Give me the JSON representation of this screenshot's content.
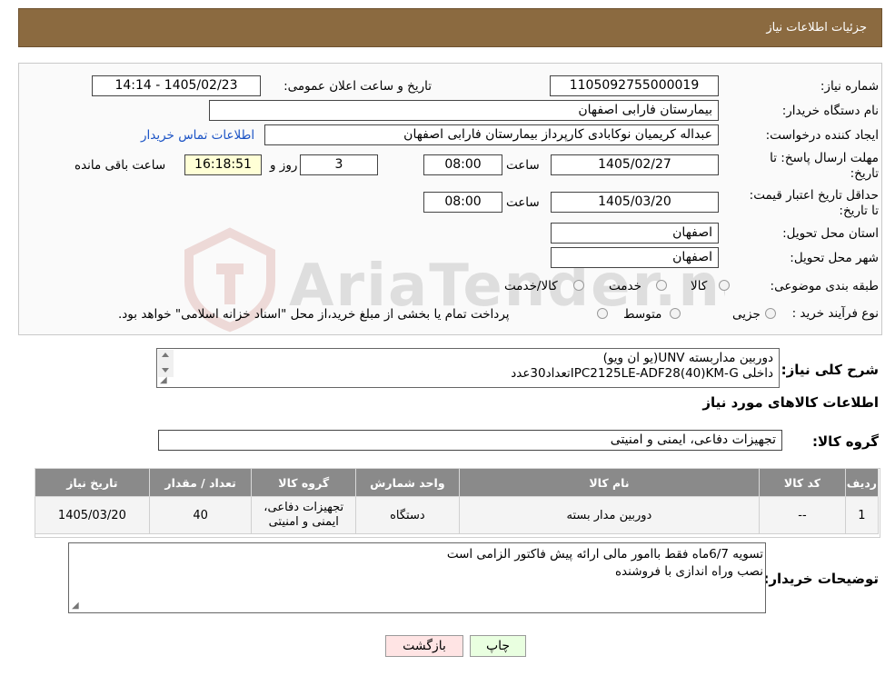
{
  "header": {
    "title": "جزئیات اطلاعات نیاز"
  },
  "form": {
    "need_number_label": "شماره نیاز:",
    "need_number": "1105092755000019",
    "announce_label": "تاریخ و ساعت اعلان عمومی:",
    "announce_value": "1405/02/23 - 14:14",
    "buyer_org_label": "نام دستگاه خریدار:",
    "buyer_org": "بیمارستان فارابی اصفهان",
    "creator_label": "ایجاد کننده درخواست:",
    "creator": "عبداله کریمیان نوکابادی کارپرداز بیمارستان فارابی اصفهان",
    "contact_link": "اطلاعات تماس خریدار",
    "deadline_label": "مهلت ارسال پاسخ: تا تاریخ:",
    "deadline_date": "1405/02/27",
    "time_label": "ساعت",
    "deadline_time": "08:00",
    "days_value": "3",
    "days_label": "روز و",
    "remaining_time": "16:18:51",
    "remaining_label": "ساعت باقی مانده",
    "validity_label": "حداقل تاریخ اعتبار قیمت: تا تاریخ:",
    "validity_date": "1405/03/20",
    "validity_time": "08:00",
    "province_label": "استان محل تحویل:",
    "province": "اصفهان",
    "city_label": "شهر محل تحویل:",
    "city": "اصفهان",
    "category_label": "طبقه بندی موضوعی:",
    "category_options": [
      "کالا",
      "خدمت",
      "کالا/خدمت"
    ],
    "process_label": "نوع فرآیند خرید :",
    "process_options": [
      "جزیی",
      "متوسط"
    ],
    "process_note": "پرداخت تمام یا بخشی از مبلغ خرید،از محل \"اسناد خزانه اسلامی\" خواهد بود."
  },
  "description": {
    "label": "شرح کلی نیاز:",
    "line1": "دوربین مداربسته UNV(یو ان ویو)",
    "line2": "داخلی IPC2125LE-ADF28(40)KM-Gتعداد30عدد"
  },
  "goods": {
    "section_title": "اطلاعات کالاهای مورد نیاز",
    "group_label": "گروه کالا:",
    "group_value": "تجهیزات دفاعی، ایمنی و امنیتی",
    "columns": [
      "ردیف",
      "کد کالا",
      "نام کالا",
      "واحد شمارش",
      "گروه کالا",
      "تعداد / مقدار",
      "تاریخ نیاز"
    ],
    "rows": [
      [
        "1",
        "--",
        "دوربین مدار بسته",
        "دستگاه",
        "تجهیزات دفاعی، ایمنی و امنیتی",
        "40",
        "1405/03/20"
      ]
    ]
  },
  "buyer_notes": {
    "label": "توضیحات خریدار:",
    "line1": "تسویه 6/7ماه فقط باامور مالی ارائه پیش فاکتور الزامی است",
    "line2": "نصب وراه اندازی با فروشنده"
  },
  "buttons": {
    "print": "چاپ",
    "back": "بازگشت"
  },
  "watermark": {
    "text": "AriaTender.neT"
  },
  "colors": {
    "header_bg": "#8b6a40",
    "table_header_bg": "#8a8a8a",
    "link": "#1b53c5",
    "back_button_bg": "#ffe4e4",
    "print_button_bg": "#e9ffe0"
  }
}
